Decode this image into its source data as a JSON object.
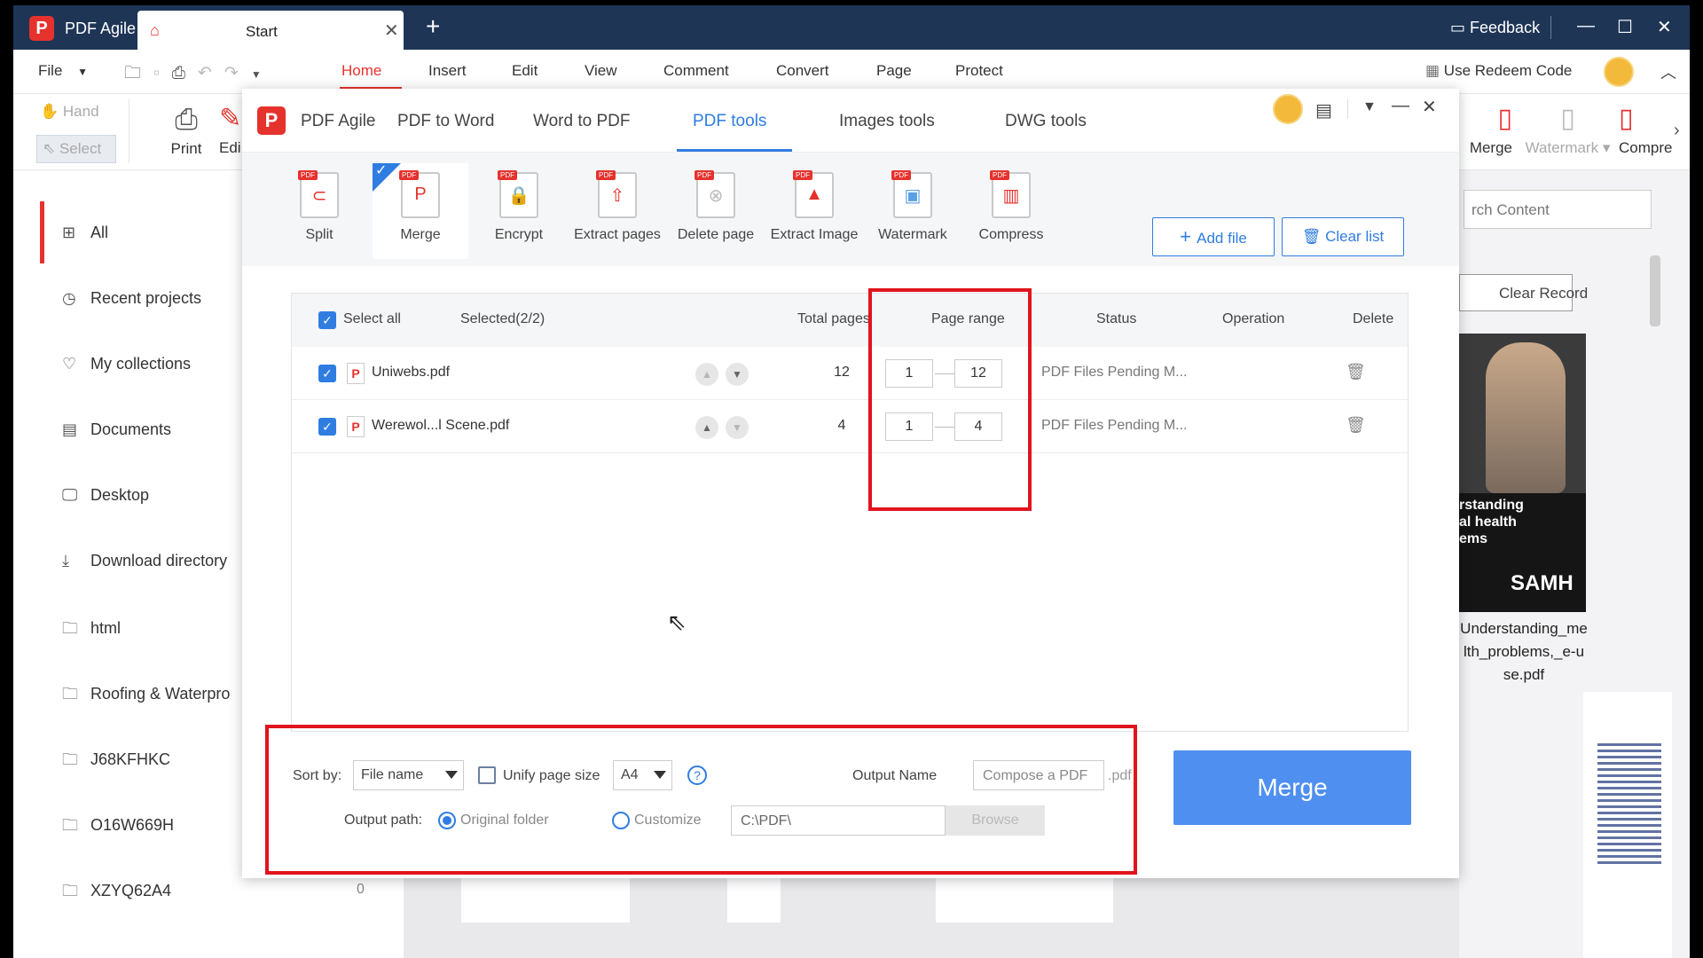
{
  "titlebar": {
    "app_name": "PDF Agile",
    "tab_label": "Start",
    "feedback_label": "Feedback"
  },
  "menubar": {
    "file_label": "File",
    "tabs": [
      "Home",
      "Insert",
      "Edit",
      "View",
      "Comment",
      "Convert",
      "Page",
      "Protect"
    ],
    "redeem_label": "Use Redeem Code"
  },
  "ribbon": {
    "hand_label": "Hand",
    "select_label": "Select",
    "print_label": "Print",
    "edit_label": "Edi",
    "merge_label": "Merge",
    "watermark_label": "Watermark",
    "compress_label": "Compre"
  },
  "sidebar": {
    "items": [
      {
        "icon": "grid-icon",
        "label": "All"
      },
      {
        "icon": "clock-icon",
        "label": "Recent projects"
      },
      {
        "icon": "heart-icon",
        "label": "My collections"
      },
      {
        "icon": "document-icon",
        "label": "Documents"
      },
      {
        "icon": "desktop-icon",
        "label": "Desktop"
      },
      {
        "icon": "download-icon",
        "label": "Download directory"
      },
      {
        "icon": "folder-icon",
        "label": "html"
      },
      {
        "icon": "folder-icon",
        "label": "Roofing & Waterpro"
      },
      {
        "icon": "folder-icon",
        "label": "J68KFHKC"
      },
      {
        "icon": "folder-icon",
        "label": "O16W669H"
      },
      {
        "icon": "folder-icon",
        "label": "XZYQ62A4"
      }
    ],
    "count_value": "0"
  },
  "rightpanel": {
    "search_placeholder": "rch Content",
    "clear_record_label": "Clear Record",
    "thumb_text_lines": [
      "rstanding",
      "al health",
      "ems"
    ],
    "thumb_brand": "SAMH",
    "file_caption_lines": [
      "Understanding_me",
      "lth_problems,_e-u",
      "se.pdf"
    ]
  },
  "dialog": {
    "logo_letter": "P",
    "header_tabs": [
      "PDF Agile",
      "PDF to Word",
      "Word to PDF",
      "PDF tools",
      "Images tools",
      "DWG tools"
    ],
    "tools": [
      "Split",
      "Merge",
      "Encrypt",
      "Extract pages",
      "Delete page",
      "Extract Image",
      "Watermark",
      "Compress"
    ],
    "add_file_label": "Add file",
    "clear_list_label": "Clear list",
    "table": {
      "select_all_label": "Select all",
      "selected_label": "Selected(2/2)",
      "headers": {
        "total_pages": "Total pages",
        "page_range": "Page range",
        "status": "Status",
        "operation": "Operation",
        "delete": "Delete"
      },
      "rows": [
        {
          "name": "Uniwebs.pdf",
          "total": "12",
          "from": "1",
          "to": "12",
          "status": "PDF Files Pending M..."
        },
        {
          "name": "Werewol...l Scene.pdf",
          "total": "4",
          "from": "1",
          "to": "4",
          "status": "PDF Files Pending M..."
        }
      ]
    },
    "options": {
      "sort_by_label": "Sort by:",
      "sort_value": "File name",
      "unify_label": "Unify page size",
      "page_size_value": "A4",
      "output_name_label": "Output Name",
      "output_name_placeholder": "Compose a PDF",
      "ext_label": ".pdf",
      "output_path_label": "Output path:",
      "original_folder_label": "Original folder",
      "customize_label": "Customize",
      "path_value": "C:\\PDF\\",
      "browse_label": "Browse"
    },
    "merge_label": "Merge"
  },
  "colors": {
    "brand_red": "#e5322d",
    "accent_blue": "#2f7de1",
    "merge_blue": "#4f8ff0",
    "highlight_red": "#e0141e",
    "titlebar": "#1e3556"
  }
}
